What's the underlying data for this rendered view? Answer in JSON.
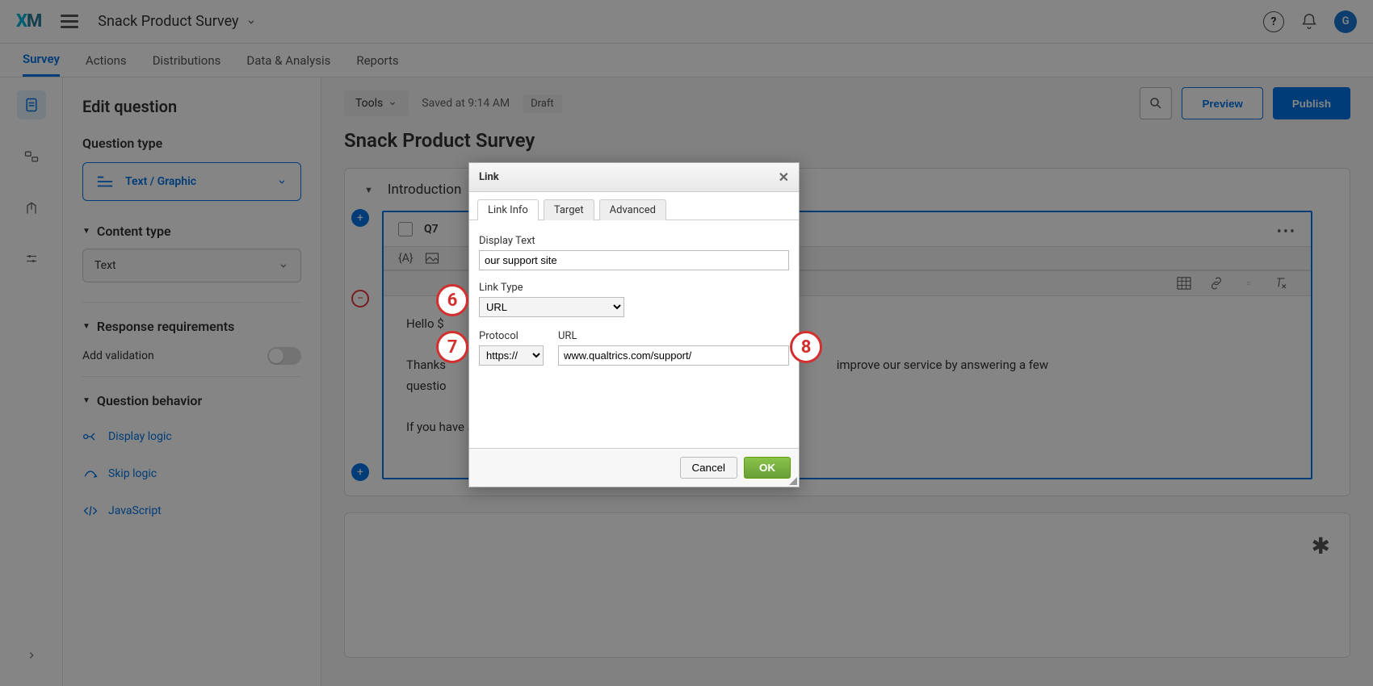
{
  "topbar": {
    "logo_text": "XM",
    "project_name": "Snack Product Survey",
    "avatar_initial": "G"
  },
  "nav": {
    "tabs": [
      "Survey",
      "Actions",
      "Distributions",
      "Data & Analysis",
      "Reports"
    ],
    "active": 0
  },
  "sidebar": {
    "title": "Edit question",
    "question_type_label": "Question type",
    "type_value": "Text / Graphic",
    "content_type_label": "Content type",
    "content_value": "Text",
    "response_req_label": "Response requirements",
    "add_validation_label": "Add validation",
    "behavior_label": "Question behavior",
    "behavior_items": [
      "Display logic",
      "Skip logic",
      "JavaScript"
    ]
  },
  "canvas": {
    "tools_label": "Tools",
    "saved_text": "Saved at 9:14 AM",
    "draft_label": "Draft",
    "preview_label": "Preview",
    "publish_label": "Publish",
    "survey_title": "Snack Product Survey",
    "block_name": "Introduction",
    "question_id": "Q7",
    "piped_token": "{A}",
    "body_line1": "Hello $",
    "body_line2": "Thanks ... improve our service by answering a few questio...",
    "body_line2_full_prefix": "Thanks",
    "body_line2_full_suffix": "improve our service by answering a few",
    "body_line2b": "questio",
    "body_line3": "If you have any other questions, please visit our support site."
  },
  "dialog": {
    "title": "Link",
    "tabs": [
      "Link Info",
      "Target",
      "Advanced"
    ],
    "display_text_label": "Display Text",
    "display_text_value": "our support site",
    "link_type_label": "Link Type",
    "link_type_value": "URL",
    "protocol_label": "Protocol",
    "protocol_value": "https://",
    "url_label": "URL",
    "url_value": "www.qualtrics.com/support/",
    "cancel_label": "Cancel",
    "ok_label": "OK"
  },
  "callouts": {
    "c6": "6",
    "c7": "7",
    "c8": "8"
  }
}
